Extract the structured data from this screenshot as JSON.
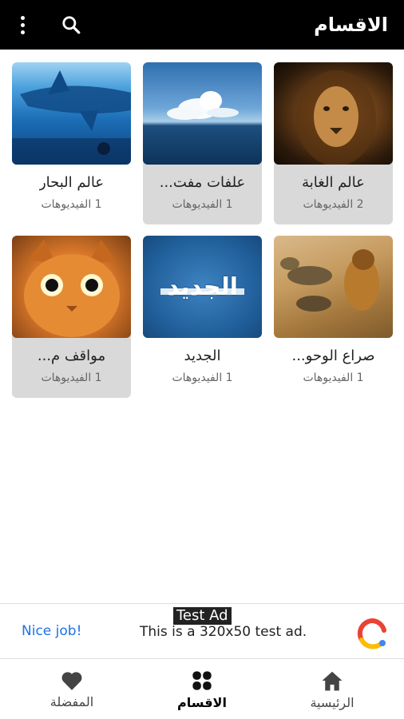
{
  "header": {
    "title": "الاقسام",
    "menu_icon": "kebab-menu-icon",
    "search_icon": "search-icon"
  },
  "categories": [
    {
      "name": "عالم الغابة",
      "count": "2 الفيديوهات",
      "thumb": "lion"
    },
    {
      "name": "علفات مفت...",
      "count": "1 الفيديوهات",
      "thumb": "ocean"
    },
    {
      "name": "عالم البحار",
      "count": "1 الفيديوهات",
      "thumb": "sea"
    },
    {
      "name": "صراع الوحو...",
      "count": "1 الفيديوهات",
      "thumb": "fight"
    },
    {
      "name": "الجديد",
      "count": "1 الفيديوهات",
      "thumb": "jadeed",
      "thumb_text": "الجديد"
    },
    {
      "name": "مواقف م...",
      "count": "1 الفيديوهات",
      "thumb": "cat"
    }
  ],
  "ad": {
    "tag": "Test Ad",
    "cta": "Nice job!",
    "text": "This is a 320x50 test ad.",
    "colors": {
      "cta": "#1a73e8"
    }
  },
  "bottom_nav": {
    "items": [
      {
        "label": "الرئيسية",
        "icon": "home-icon",
        "active": false
      },
      {
        "label": "الاقسام",
        "icon": "grid-icon",
        "active": true
      },
      {
        "label": "المفضلة",
        "icon": "heart-icon",
        "active": false
      }
    ]
  },
  "colors": {
    "topbar": "#000000",
    "card_shade": "#d9d9d9"
  }
}
